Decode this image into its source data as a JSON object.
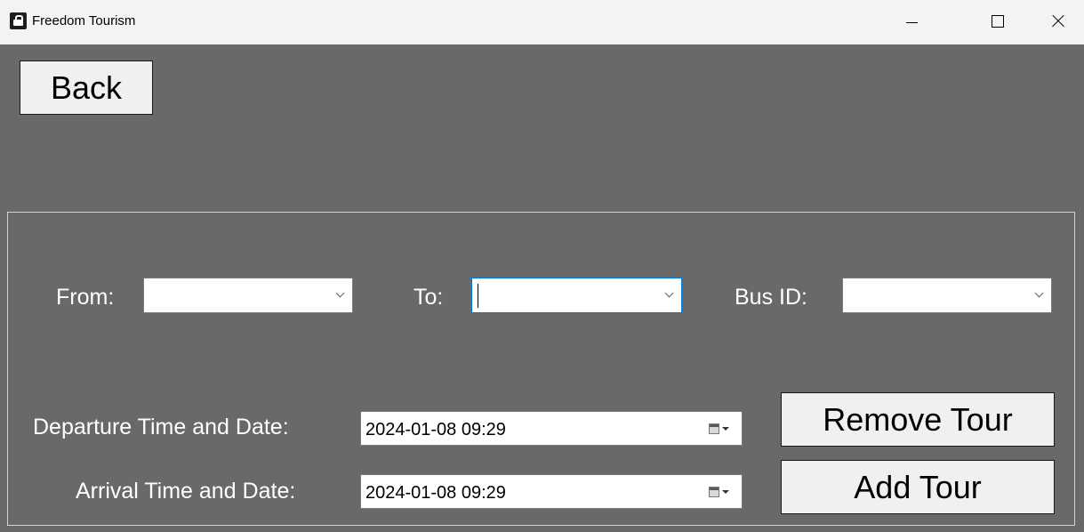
{
  "window": {
    "title": "Freedom Tourism",
    "icon": "lock-icon"
  },
  "toolbar": {
    "back_label": "Back"
  },
  "form": {
    "from_label": "From:",
    "from_value": "",
    "to_label": "To:",
    "to_value": "",
    "busid_label": "Bus ID:",
    "busid_value": "",
    "departure_label": "Departure Time and Date:",
    "departure_value": "2024-01-08 09:29",
    "arrival_label": "Arrival Time and Date:",
    "arrival_value": "2024-01-08 09:29"
  },
  "actions": {
    "remove_label": "Remove Tour",
    "add_label": "Add Tour"
  },
  "colors": {
    "background": "#696969",
    "titlebar": "#f3f3f3",
    "button_face": "#f0f0f0",
    "focus_border": "#0078d7"
  }
}
